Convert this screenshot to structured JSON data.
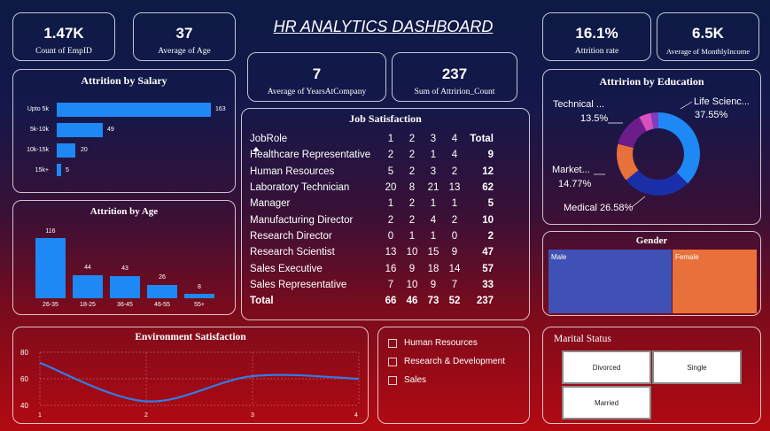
{
  "dashboard": {
    "title": "HR ANALYTICS DASHBOARD"
  },
  "kpis": {
    "emp_count": {
      "value": "1.47K",
      "label": "Count of EmpID"
    },
    "avg_age": {
      "value": "37",
      "label": "Average of Age"
    },
    "avg_years": {
      "value": "7",
      "label": "Average of YearsAtCompany"
    },
    "sum_attrition": {
      "value": "237",
      "label": "Sum of Attririon_Count"
    },
    "attrition_rate": {
      "value": "16.1%",
      "label": "Attrition rate"
    },
    "avg_income": {
      "value": "6.5K",
      "label": "Average of MonthlyIncome"
    }
  },
  "attrition_by_salary": {
    "title": "Attrition by Salary",
    "categories": [
      "Upto 5k",
      "5k-10k",
      "10k-15k",
      "15k+"
    ],
    "values": [
      163,
      49,
      20,
      5
    ],
    "value_labels": [
      "163",
      "49",
      "20",
      "5"
    ]
  },
  "attrition_by_age": {
    "title": "Attrition by Age",
    "categories": [
      "26-35",
      "18-25",
      "36-45",
      "46-55",
      "55+"
    ],
    "values": [
      116,
      44,
      43,
      26,
      8
    ],
    "value_labels": [
      "116",
      "44",
      "43",
      "26",
      "8"
    ]
  },
  "job_satisfaction": {
    "title": "Job Satisfaction",
    "headers": [
      "JobRole",
      "1",
      "2",
      "3",
      "4",
      "Total"
    ],
    "rows": [
      {
        "role": "Healthcare Representative",
        "v1": "2",
        "v2": "2",
        "v3": "1",
        "v4": "4",
        "total": "9"
      },
      {
        "role": "Human Resources",
        "v1": "5",
        "v2": "2",
        "v3": "3",
        "v4": "2",
        "total": "12"
      },
      {
        "role": "Laboratory Technician",
        "v1": "20",
        "v2": "8",
        "v3": "21",
        "v4": "13",
        "total": "62"
      },
      {
        "role": "Manager",
        "v1": "1",
        "v2": "2",
        "v3": "1",
        "v4": "1",
        "total": "5"
      },
      {
        "role": "Manufacturing Director",
        "v1": "2",
        "v2": "2",
        "v3": "4",
        "v4": "2",
        "total": "10"
      },
      {
        "role": "Research Director",
        "v1": "0",
        "v2": "1",
        "v3": "1",
        "v4": "0",
        "total": "2"
      },
      {
        "role": "Research Scientist",
        "v1": "13",
        "v2": "10",
        "v3": "15",
        "v4": "9",
        "total": "47"
      },
      {
        "role": "Sales Executive",
        "v1": "16",
        "v2": "9",
        "v3": "18",
        "v4": "14",
        "total": "57"
      },
      {
        "role": "Sales Representative",
        "v1": "7",
        "v2": "10",
        "v3": "9",
        "v4": "7",
        "total": "33"
      }
    ],
    "total_row": {
      "role": "Total",
      "v1": "66",
      "v2": "46",
      "v3": "73",
      "v4": "52",
      "total": "237"
    }
  },
  "attrition_by_education": {
    "title": "Attririon by Education",
    "labels": {
      "life": "Life Scienc...",
      "life_pct": "37.55%",
      "technical": "Technical ...",
      "technical_pct": "13.5%",
      "marketing": "Market...",
      "marketing_pct": "14.77%",
      "medical": "Medical 26.58%"
    },
    "slices": [
      {
        "value": 37.55,
        "color": "#1e88f5"
      },
      {
        "value": 26.58,
        "color": "#1a2ea8"
      },
      {
        "value": 14.77,
        "color": "#e8703a"
      },
      {
        "value": 13.5,
        "color": "#6b1d8a"
      },
      {
        "value": 4.64,
        "color": "#d94fbf"
      },
      {
        "value": 2.96,
        "color": "#7b3fbf"
      }
    ]
  },
  "gender": {
    "title": "Gender",
    "male_label": "Male",
    "female_label": "Female",
    "male_color": "#4051b5",
    "female_color": "#e8703a"
  },
  "environment_satisfaction": {
    "title": "Environment Satisfaction",
    "y_ticks": [
      "80",
      "60",
      "40"
    ],
    "x_ticks": [
      "1",
      "2",
      "3",
      "4"
    ]
  },
  "chart_data": {
    "type": "line",
    "x": [
      1,
      2,
      3,
      4
    ],
    "values": [
      72,
      43,
      62,
      60
    ],
    "xlabel": "",
    "ylabel": "",
    "ylim": [
      40,
      80
    ]
  },
  "department_slicer": {
    "items": [
      "Human Resources",
      "Research & Development",
      "Sales"
    ]
  },
  "marital_status": {
    "title": "Marital Status",
    "options": [
      "Divorced",
      "Single",
      "Married"
    ]
  }
}
